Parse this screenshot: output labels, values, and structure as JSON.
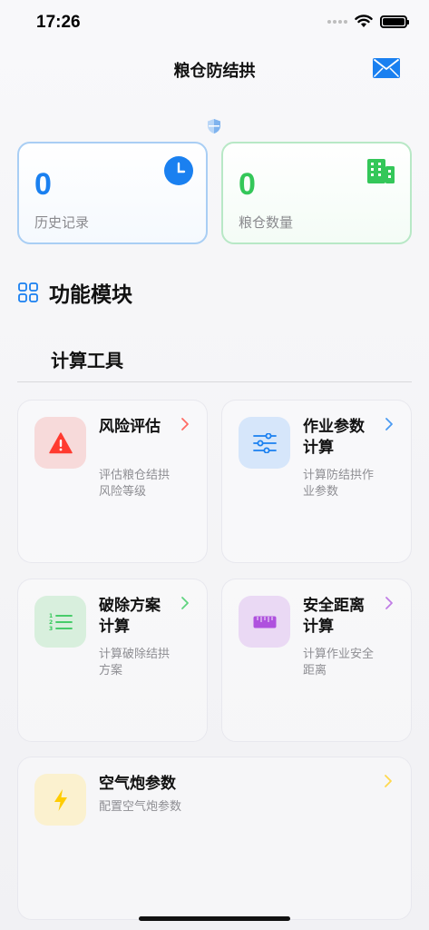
{
  "status_bar": {
    "time": "17:26"
  },
  "nav": {
    "title": "粮仓防结拱"
  },
  "stats": [
    {
      "value": "0",
      "label": "历史记录",
      "icon": "clock-icon",
      "color": "#1a80f0"
    },
    {
      "value": "0",
      "label": "粮仓数量",
      "icon": "building-icon",
      "color": "#34c759"
    }
  ],
  "section": {
    "title": "功能模块",
    "icon": "grid-icon"
  },
  "subsection": {
    "title": "计算工具"
  },
  "tools": [
    {
      "title": "风险评估",
      "desc": "评估粮仓结拱风险等级",
      "icon": "warning-icon",
      "color": "#ff3b30"
    },
    {
      "title": "作业参数计算",
      "desc": "计算防结拱作业参数",
      "icon": "sliders-icon",
      "color": "#1a80f0"
    },
    {
      "title": "破除方案计算",
      "desc": "计算破除结拱方案",
      "icon": "list-numbered-icon",
      "color": "#34c759"
    },
    {
      "title": "安全距离计算",
      "desc": "计算作业安全距离",
      "icon": "ruler-icon",
      "color": "#af52de"
    },
    {
      "title": "空气炮参数",
      "desc": "配置空气炮参数",
      "icon": "bolt-icon",
      "color": "#ffcc00"
    }
  ]
}
